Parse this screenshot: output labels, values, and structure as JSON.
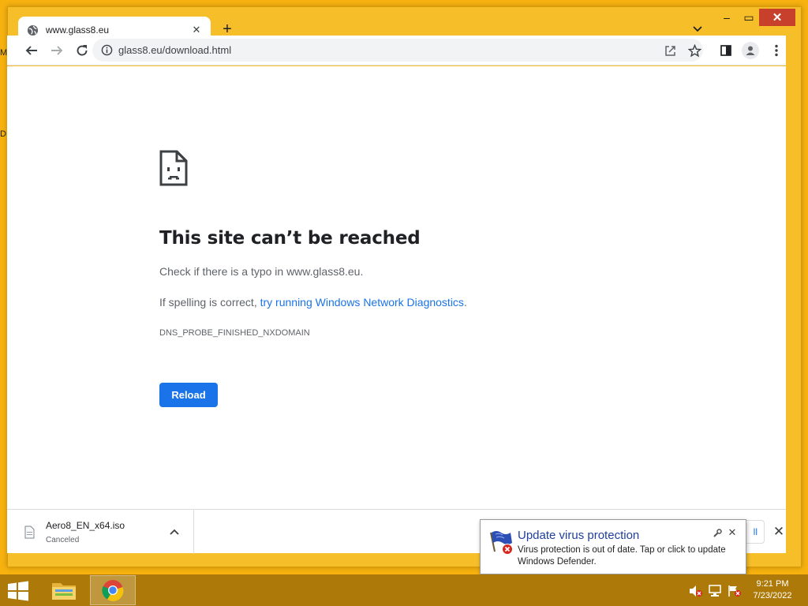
{
  "desktop": {
    "edge_labels": [
      "M",
      "D"
    ]
  },
  "window_controls": {
    "minimize": "‒",
    "maximize": "▭",
    "close": "✕"
  },
  "tab": {
    "title": "www.glass8.eu",
    "close": "✕"
  },
  "new_tab": "+",
  "toolbar": {
    "url": "glass8.eu/download.html"
  },
  "error": {
    "title": "This site can’t be reached",
    "line1": "Check if there is a typo in www.glass8.eu.",
    "line2_prefix": "If spelling is correct, ",
    "line2_link": "try running Windows Network Diagnostics",
    "line2_suffix": ".",
    "code": "DNS_PROBE_FINISHED_NXDOMAIN",
    "reload_label": "Reload"
  },
  "download_shelf": {
    "file_name": "Aero8_EN_x64.iso",
    "status": "Canceled",
    "show_all_partial": "ll",
    "close": "✕"
  },
  "toast": {
    "title": "Update virus protection",
    "body": "Virus protection is out of date. Tap or click to update Windows Defender.",
    "close": "✕"
  },
  "taskbar": {
    "time": "9:21 PM",
    "date": "7/23/2022",
    "accent": "#ad7a09"
  },
  "colors": {
    "desktop": "#f7b20f",
    "link": "#1a73e8",
    "reload_button": "#1a73e8"
  }
}
